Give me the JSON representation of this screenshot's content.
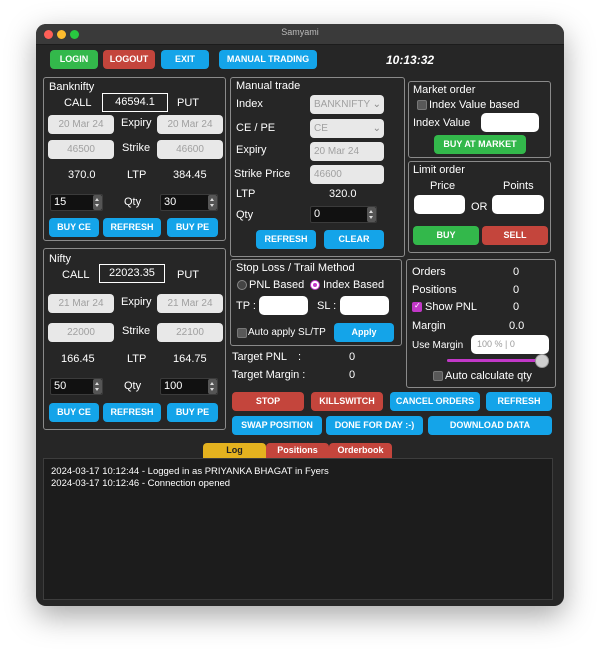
{
  "window": {
    "title": "Samyami"
  },
  "toolbar": {
    "login": "LOGIN",
    "logout": "LOGOUT",
    "exit": "EXIT",
    "manual_trading": "MANUAL TRADING",
    "clock": "10:13:32"
  },
  "banknifty": {
    "title": "Banknifty",
    "call_label": "CALL",
    "put_label": "PUT",
    "index_value": "46594.1",
    "call_expiry": "20 Mar 24",
    "expiry_label": "Expiry",
    "put_expiry": "20 Mar 24",
    "call_strike": "46500",
    "strike_label": "Strike",
    "put_strike": "46600",
    "call_ltp": "370.0",
    "ltp_label": "LTP",
    "put_ltp": "384.45",
    "call_qty": "15",
    "qty_label": "Qty",
    "put_qty": "30",
    "buy_ce": "BUY CE",
    "refresh": "REFRESH",
    "buy_pe": "BUY PE"
  },
  "nifty": {
    "title": "Nifty",
    "call_label": "CALL",
    "put_label": "PUT",
    "index_value": "22023.35",
    "call_expiry": "21 Mar 24",
    "expiry_label": "Expiry",
    "put_expiry": "21 Mar 24",
    "call_strike": "22000",
    "strike_label": "Strike",
    "put_strike": "22100",
    "call_ltp": "166.45",
    "ltp_label": "LTP",
    "put_ltp": "164.75",
    "call_qty": "50",
    "qty_label": "Qty",
    "put_qty": "100",
    "buy_ce": "BUY CE",
    "refresh": "REFRESH",
    "buy_pe": "BUY PE"
  },
  "manual_trade": {
    "title": "Manual trade",
    "index_label": "Index",
    "index_value": "BANKNIFTY",
    "cepe_label": "CE / PE",
    "cepe_value": "CE",
    "expiry_label": "Expiry",
    "expiry_value": "20 Mar 24",
    "strike_label": "Strike Price",
    "strike_value": "46600",
    "ltp_label": "LTP",
    "ltp_value": "320.0",
    "qty_label": "Qty",
    "qty_value": "0",
    "refresh": "REFRESH",
    "clear": "CLEAR"
  },
  "market_order": {
    "title": "Market order",
    "index_value_based": "Index Value based",
    "index_value_label": "Index Value",
    "index_value": "",
    "buy_at_market": "BUY AT MARKET"
  },
  "limit_order": {
    "title": "Limit order",
    "price_label": "Price",
    "points_label": "Points",
    "or_label": "OR",
    "price": "",
    "points": "",
    "buy": "BUY",
    "sell": "SELL"
  },
  "stop_loss": {
    "title": "Stop Loss / Trail Method",
    "pnl_based": "PNL Based",
    "index_based": "Index Based",
    "selected": "Index Based",
    "tp_label": "TP :",
    "sl_label": "SL :",
    "tp": "",
    "sl": "",
    "auto_apply": "Auto apply SL/TP",
    "apply": "Apply"
  },
  "targets": {
    "pnl_label": "Target PNL",
    "pnl_sep": ":",
    "pnl_value": "0",
    "margin_label": "Target Margin :",
    "margin_value": "0"
  },
  "summary": {
    "orders_label": "Orders",
    "orders_value": "0",
    "positions_label": "Positions",
    "positions_value": "0",
    "show_pnl_label": "Show PNL",
    "show_pnl_checked": true,
    "show_pnl_value": "0",
    "margin_label": "Margin",
    "margin_value": "0.0",
    "use_margin_label": "Use Margin",
    "use_margin_placeholder": "100 % | 0",
    "use_margin_level": 1.0,
    "auto_calc_label": "Auto calculate qty"
  },
  "actions": {
    "stop": "STOP",
    "killswitch": "KILLSWITCH",
    "cancel_orders": "CANCEL ORDERS",
    "refresh": "REFRESH",
    "swap_position": "SWAP POSITION",
    "done_for_day": "DONE FOR DAY :-)",
    "download_data": "DOWNLOAD DATA"
  },
  "tabs": [
    "Log",
    "Positions",
    "Orderbook"
  ],
  "log": [
    "2024-03-17 10:12:44 - Logged in as PRIYANKA BHAGAT in Fyers",
    "2024-03-17 10:12:46 - Connection opened"
  ],
  "colors": {
    "green": "#33b84b",
    "red": "#c4453c",
    "blue": "#14a4e9",
    "tab_log": "#e4b21f",
    "tab_positions": "#c4453c",
    "tab_orderbook": "#c4453c",
    "show_pnl_check": "#c238c8"
  }
}
